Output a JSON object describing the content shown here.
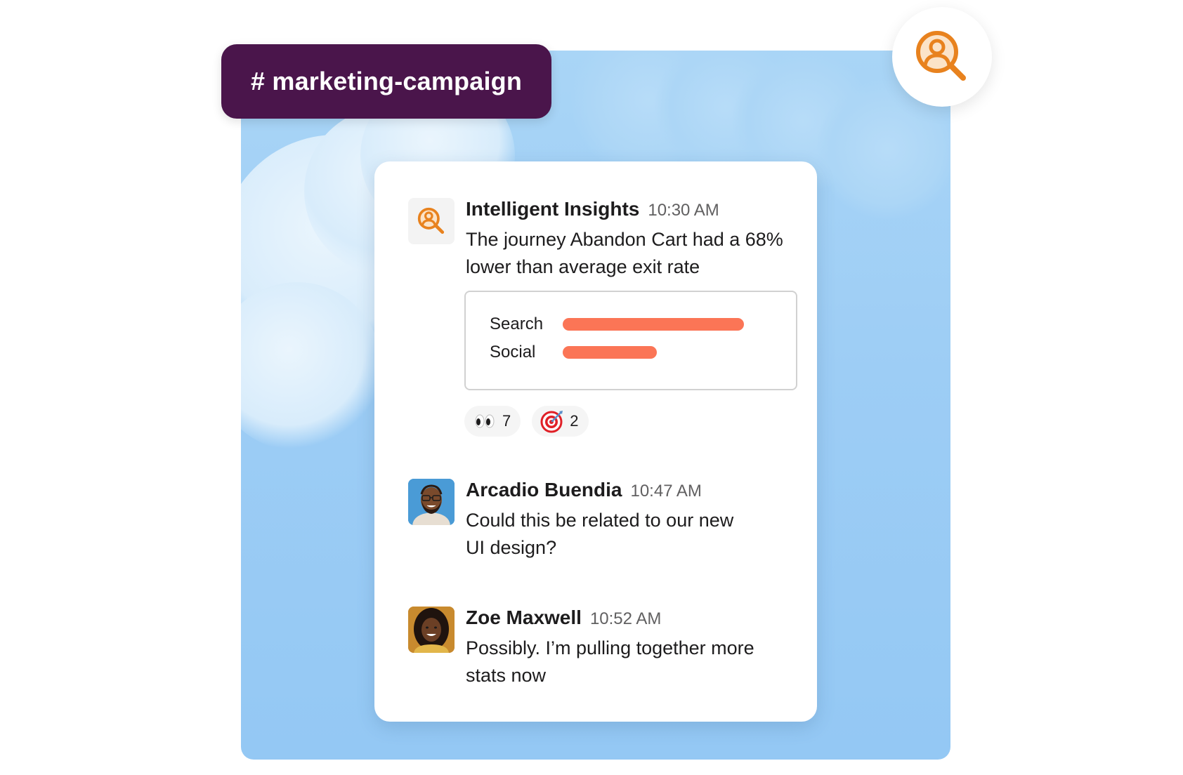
{
  "channel": {
    "name": "# marketing-campaign"
  },
  "badge": {
    "icon": "person-magnifier-icon",
    "accent": "#e8821e"
  },
  "messages": [
    {
      "sender": "Intelligent Insights",
      "time": "10:30 AM",
      "text": "The journey Abandon Cart had a 68% lower than average exit rate",
      "avatar": "person-magnifier-icon"
    },
    {
      "sender": "Arcadio Buendia",
      "time": "10:47 AM",
      "text": "Could this be related to our new UI design?",
      "avatar": "man-portrait"
    },
    {
      "sender": "Zoe Maxwell",
      "time": "10:52 AM",
      "text": "Possibly. I’m pulling together more stats now",
      "avatar": "woman-portrait"
    }
  ],
  "chart_data": {
    "type": "bar",
    "orientation": "horizontal",
    "categories": [
      "Search",
      "Social"
    ],
    "values": [
      100,
      52
    ],
    "bar_color": "#fb7556"
  },
  "reactions": [
    {
      "emoji": "eyes",
      "count": "7"
    },
    {
      "emoji": "direct-hit",
      "count": "2"
    }
  ],
  "colors": {
    "channel_bg": "#4a154b",
    "sky": "#9dcdf5",
    "card": "#ffffff"
  }
}
